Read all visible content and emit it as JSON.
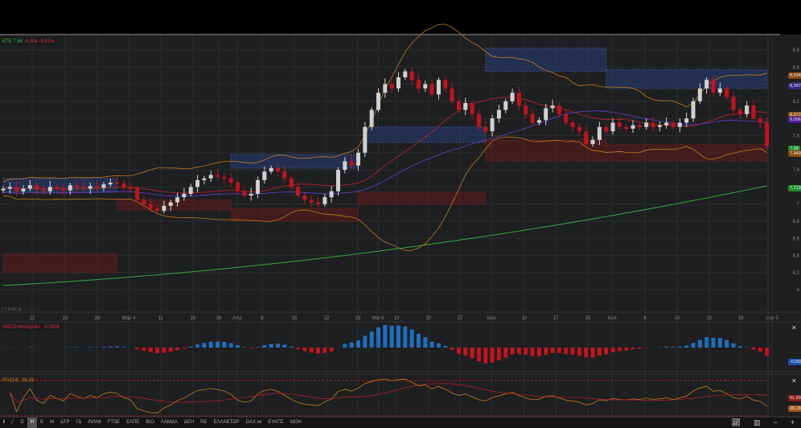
{
  "symbol_legend": {
    "symbol": "ΕΤΕ",
    "price": "7,68",
    "change": "-0,304",
    "change_pct": "-3,81%"
  },
  "watermark": "ZTRADE",
  "macd_legend": {
    "label": "MACD-Histogram",
    "value": "-0,0508"
  },
  "rsi_legend": {
    "label": "RSI(14)",
    "value": "38,28"
  },
  "price_tags": [
    {
      "text": "8,524",
      "color": "#8a4a12"
    },
    {
      "text": "8,397",
      "color": "#3a2a8a"
    },
    {
      "text": "8,0727",
      "color": "#8a4a12"
    },
    {
      "text": "8,0065",
      "color": "#4a1a9a"
    },
    {
      "text": "7,68",
      "color": "#1f8a2a"
    },
    {
      "text": "7,649",
      "color": "#8a4a12"
    },
    {
      "text": "7,2190",
      "color": "#1f8a2a"
    }
  ],
  "macd_tag": {
    "text": "-0,0508",
    "color": "#1a4fa8"
  },
  "rsi_tags": [
    {
      "text": "51,99",
      "color": "#8a1a1a"
    },
    {
      "text": "38,28",
      "color": "#a0521a"
    }
  ],
  "close_icon": "✕",
  "toolbar": {
    "items": [
      "Ω",
      "Η",
      "Ε",
      "Μ",
      "ΔΤΡ",
      "ΓΔ",
      "ΙΝΛΙΦ",
      "FTSE",
      "ΕΛΠΕ",
      "ΒΙΟ",
      "ΛΑΜΔΑ",
      "ΔΕΗ",
      "RE",
      "ΕΛΛΑΚΤΩΡ",
      "DAX.wi",
      "ΕΥΑΠΣ",
      "ΜΟΗ"
    ],
    "active": "Η",
    "info": "i"
  },
  "chart_data": {
    "type": "candlestick",
    "title": "ΕΤΕ",
    "y_ticks": [
      "8,8",
      "8,6",
      "8,4",
      "8,2",
      "8",
      "7,8",
      "7,6",
      "7,4",
      "7,2",
      "7",
      "6,8",
      "6,6",
      "6,4",
      "6,2",
      "6"
    ],
    "ylim": [
      5.98,
      9.0
    ],
    "x_ticks": [
      "12",
      "19",
      "26",
      "Μαρ 4",
      "11",
      "19",
      "26",
      "Απρ",
      "8",
      "15",
      "22",
      "29",
      "Μαι 8",
      "13",
      "20",
      "27",
      "Ιουν",
      "10",
      "17",
      "25",
      "Ιουλ",
      "8",
      "15",
      "22",
      "29",
      "Αυγ 5"
    ],
    "closes": [
      7.18,
      7.2,
      7.15,
      7.18,
      7.22,
      7.17,
      7.15,
      7.2,
      7.18,
      7.16,
      7.22,
      7.2,
      7.18,
      7.21,
      7.19,
      7.23,
      7.25,
      7.24,
      7.2,
      7.18,
      7.05,
      7.0,
      6.95,
      6.92,
      6.98,
      7.02,
      7.08,
      7.12,
      7.2,
      7.28,
      7.3,
      7.34,
      7.32,
      7.3,
      7.25,
      7.15,
      7.1,
      7.12,
      7.28,
      7.38,
      7.42,
      7.38,
      7.3,
      7.2,
      7.1,
      7.05,
      7.02,
      7.0,
      7.08,
      7.15,
      7.4,
      7.5,
      7.45,
      7.6,
      7.9,
      8.1,
      8.3,
      8.4,
      8.35,
      8.48,
      8.55,
      8.45,
      8.35,
      8.4,
      8.28,
      8.45,
      8.35,
      8.2,
      8.1,
      8.18,
      8.05,
      7.9,
      7.85,
      8.0,
      8.1,
      8.2,
      8.3,
      8.15,
      8.05,
      7.95,
      7.98,
      8.12,
      8.15,
      8.05,
      7.95,
      7.9,
      7.85,
      7.7,
      7.75,
      7.9,
      7.85,
      7.95,
      7.9,
      7.88,
      7.92,
      7.9,
      7.95,
      7.9,
      7.92,
      7.95,
      7.9,
      7.95,
      8.0,
      8.2,
      8.35,
      8.45,
      8.3,
      8.35,
      8.25,
      8.1,
      8.05,
      8.15,
      8.0,
      7.95,
      7.68
    ],
    "ma200_range": [
      6.05,
      7.219
    ],
    "zones": [
      {
        "type": "supply",
        "from": 0,
        "to": 17,
        "low": 7.14,
        "high": 7.3
      },
      {
        "type": "supply",
        "from": 34,
        "to": 53,
        "low": 7.42,
        "high": 7.58
      },
      {
        "type": "supply",
        "from": 54,
        "to": 72,
        "low": 7.72,
        "high": 7.9
      },
      {
        "type": "supply",
        "from": 72,
        "to": 90,
        "low": 8.55,
        "high": 8.82
      },
      {
        "type": "supply",
        "from": 90,
        "to": 114,
        "low": 8.35,
        "high": 8.57
      },
      {
        "type": "demand",
        "from": 0,
        "to": 17,
        "low": 6.2,
        "high": 6.42
      },
      {
        "type": "demand",
        "from": 17,
        "to": 34,
        "low": 6.93,
        "high": 7.05
      },
      {
        "type": "demand",
        "from": 34,
        "to": 53,
        "low": 6.8,
        "high": 6.95
      },
      {
        "type": "demand",
        "from": 53,
        "to": 72,
        "low": 7.0,
        "high": 7.14
      },
      {
        "type": "demand",
        "from": 72,
        "to": 90,
        "low": 7.5,
        "high": 7.75
      },
      {
        "type": "demand",
        "from": 90,
        "to": 114,
        "low": 7.5,
        "high": 7.7
      }
    ],
    "colors": {
      "up": "#d0d0d0",
      "down": "#c0141e",
      "ma200": "#3aa63a",
      "bb": "#c47a1c",
      "ma_fast": "#c0262e",
      "ma_slow": "#6a3ad0",
      "macd_pos": "#1f6fc0",
      "macd_neg": "#c0141e",
      "rsi": "#c47a1c",
      "rsi_ma": "#b01e28"
    }
  }
}
